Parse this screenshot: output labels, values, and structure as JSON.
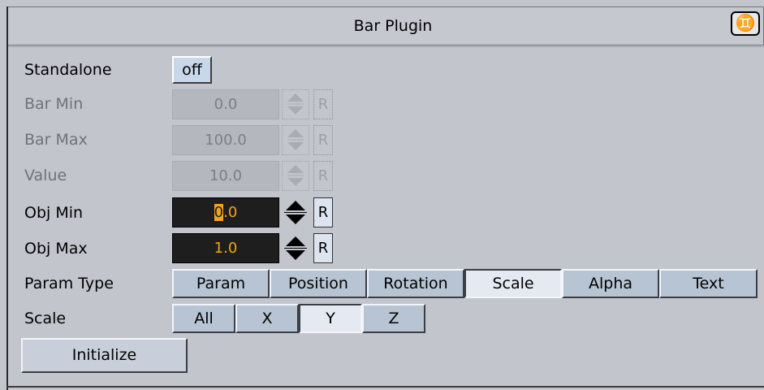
{
  "window": {
    "title": "Bar Plugin",
    "help_icon": "help-book-icon"
  },
  "rows": {
    "standalone": {
      "label": "Standalone",
      "value": "off"
    },
    "bar_min": {
      "label": "Bar Min",
      "value": "0.0",
      "reset": "R"
    },
    "bar_max": {
      "label": "Bar Max",
      "value": "100.0",
      "reset": "R"
    },
    "value": {
      "label": "Value",
      "value": "10.0",
      "reset": "R"
    },
    "obj_min": {
      "label": "Obj Min",
      "value_head": "0",
      "value_tail": ".0",
      "reset": "R"
    },
    "obj_max": {
      "label": "Obj Max",
      "value": "1.0",
      "reset": "R"
    },
    "param_type": {
      "label": "Param Type",
      "options": [
        "Param",
        "Position",
        "Rotation",
        "Scale",
        "Alpha",
        "Text"
      ],
      "selected": "Scale"
    },
    "scale": {
      "label": "Scale",
      "options": [
        "All",
        "X",
        "Y",
        "Z"
      ],
      "selected": "Y"
    }
  },
  "actions": {
    "initialize": "Initialize"
  },
  "colors": {
    "panel_bg": "#c2c5cc",
    "active_field_bg": "#1e1e1e",
    "active_field_text": "#f4a41c",
    "toggle_bg": "#c9d7ea",
    "segment_bg": "#b7c4d3",
    "segment_selected_bg": "#e4e9f2"
  }
}
